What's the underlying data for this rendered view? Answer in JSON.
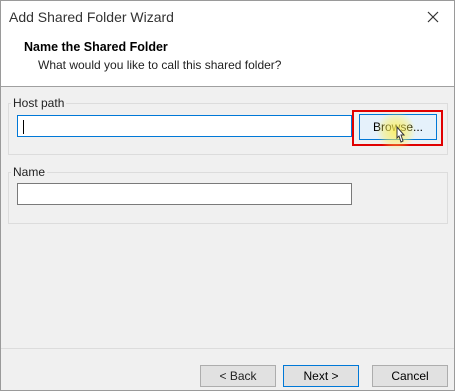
{
  "window": {
    "title": "Add Shared Folder Wizard"
  },
  "header": {
    "title": "Name the Shared Folder",
    "subtitle": "What would you like to call this shared folder?"
  },
  "host_path": {
    "label": "Host path",
    "value": "",
    "browse_label": "Browse..."
  },
  "name": {
    "label": "Name",
    "value": ""
  },
  "footer": {
    "back_label": "< Back",
    "next_label": "Next >",
    "cancel_label": "Cancel"
  },
  "colors": {
    "accent": "#0078d7",
    "highlight_box": "#e00000"
  },
  "icons": {
    "close": "close-icon",
    "cursor": "mouse-cursor-icon"
  }
}
